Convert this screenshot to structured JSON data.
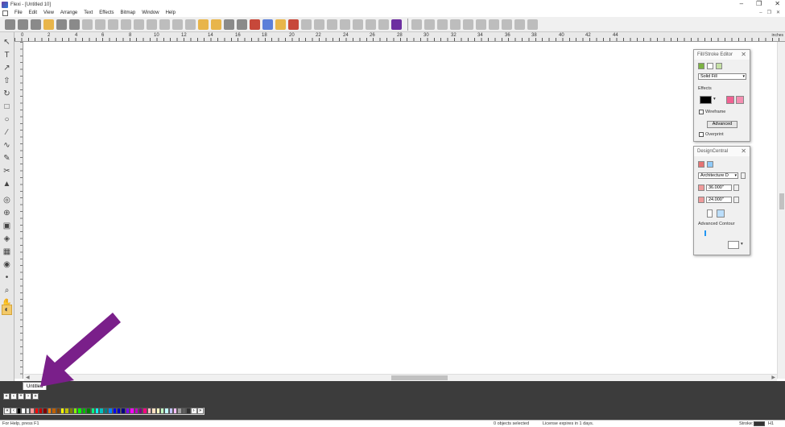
{
  "window": {
    "title": "Flexi - [Untitled 10]",
    "controls": [
      "–",
      "❐",
      "✕"
    ],
    "mdi_controls": [
      "–",
      "❐",
      "✕"
    ]
  },
  "menu": [
    "File",
    "Edit",
    "View",
    "Arrange",
    "Text",
    "Effects",
    "Bitmap",
    "Window",
    "Help"
  ],
  "ruler": {
    "units": "inches",
    "labels": [
      "0",
      "2",
      "4",
      "6",
      "8",
      "10",
      "12",
      "14",
      "16",
      "18",
      "20",
      "22",
      "24",
      "26",
      "28",
      "30",
      "32",
      "34",
      "36",
      "38",
      "40",
      "42",
      "44"
    ]
  },
  "page_tab": "Untitled",
  "fill_stroke_editor": {
    "title": "Fill/Stroke Editor",
    "fill_type": "Solid Fill",
    "section": "Effects",
    "wireframe_label": "Wireframe",
    "advanced_label": "Advanced",
    "overprint_label": "Overprint"
  },
  "design_central": {
    "title": "DesignCentral",
    "style": "Architecture D",
    "width": "36.000\"",
    "height": "24.000\"",
    "advanced_contour_label": "Advanced Contour"
  },
  "statusbar": {
    "help": "For Help, press F1",
    "selection": "0 objects selected",
    "license": "License expires in 1 days.",
    "stroke_label": "Stroke:",
    "stroke_value": "H1"
  },
  "palette_colors": [
    "#000000",
    "#ffffff",
    "#e0e0e0",
    "#ff9999",
    "#ff0000",
    "#c00000",
    "#800000",
    "#ff8000",
    "#c06000",
    "#804000",
    "#ffff00",
    "#c0c000",
    "#808000",
    "#80ff00",
    "#00ff00",
    "#00c000",
    "#008000",
    "#00ff80",
    "#00ffff",
    "#00c0c0",
    "#008080",
    "#0080ff",
    "#0000ff",
    "#0000c0",
    "#000080",
    "#8000ff",
    "#ff00ff",
    "#c000c0",
    "#800080",
    "#ff0080",
    "#ffc0c0",
    "#ffe0c0",
    "#ffffc0",
    "#c0ffc0",
    "#c0ffff",
    "#c0c0ff",
    "#ffc0ff",
    "#a0a0a0",
    "#606060",
    "#303030"
  ],
  "accent": "#7a1f8a"
}
